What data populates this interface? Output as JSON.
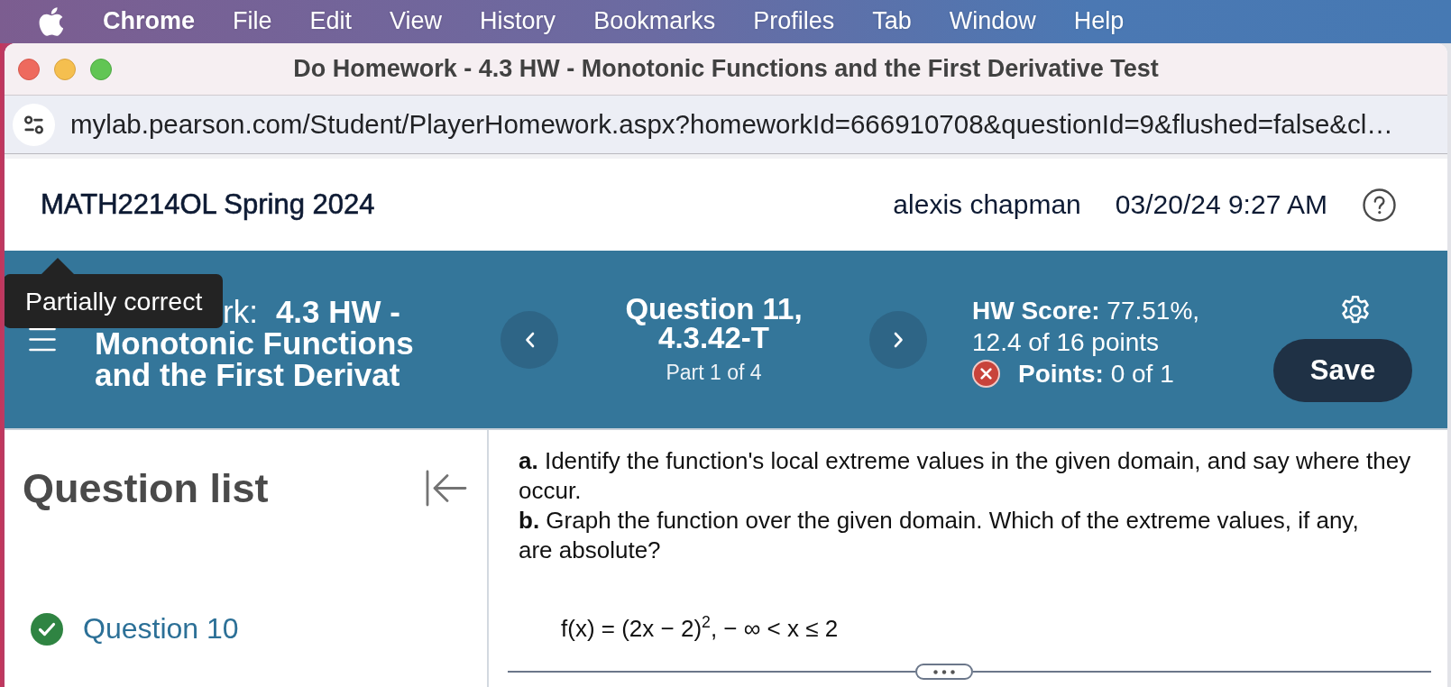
{
  "menu_bar": {
    "app_name": "Chrome",
    "items": [
      "File",
      "Edit",
      "View",
      "History",
      "Bookmarks",
      "Profiles",
      "Tab",
      "Window",
      "Help"
    ]
  },
  "window": {
    "title": "Do Homework - 4.3 HW - Monotonic Functions and the First Derivative Test"
  },
  "address_bar": {
    "url": "mylab.pearson.com/Student/PlayerHomework.aspx?homeworkId=666910708&questionId=9&flushed=false&cl…"
  },
  "header": {
    "course": "MATH2214OL Spring 2024",
    "user": "alexis chapman",
    "datetime": "03/20/24 9:27 AM"
  },
  "banner": {
    "title_label": "rk:",
    "title_lines": [
      "4.3 HW -",
      "Monotonic Functions",
      "and the First Derivat"
    ],
    "question": "Question 11, 4.3.42-T",
    "part": "Part 1 of 4",
    "score": "**HW Score:** 77.51%, 12.4 of 16 points",
    "points": {
      "text": "**Points:** 0 of 1",
      "correct": false
    },
    "save_button": "Save"
  },
  "tooltip": {
    "text": "Partially correct"
  },
  "question_list": {
    "title": "Question list",
    "items": [
      {
        "label": "Question 10",
        "correct": true
      }
    ]
  },
  "question": {
    "parts": [
      "**a.** Identify the function's local extreme values in the given domain, and say where they occur.",
      "**b.** Graph the function over the given domain. Which of the extreme values, if any, are absolute?"
    ],
    "formula": "f(x) = (2x − 2)$^{2}$, − ∞ < x ≤ 2"
  }
}
